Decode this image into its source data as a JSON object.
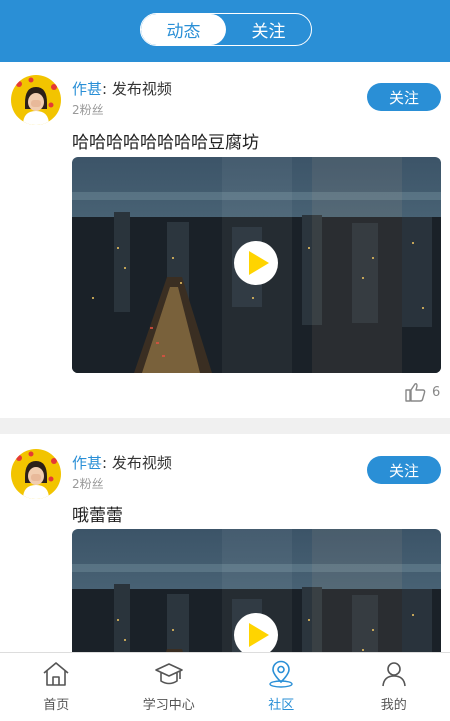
{
  "header": {
    "tabs": [
      {
        "label": "动态",
        "active": true
      },
      {
        "label": "关注",
        "active": false
      }
    ]
  },
  "posts": [
    {
      "author": "作甚",
      "action": ": 发布视频",
      "fans": "2粉丝",
      "follow_label": "关注",
      "title": "哈哈哈哈哈哈哈哈豆腐坊",
      "likes": "6"
    },
    {
      "author": "作甚",
      "action": ": 发布视频",
      "fans": "2粉丝",
      "follow_label": "关注",
      "title": "哦蕾蕾"
    }
  ],
  "tabbar": {
    "items": [
      {
        "label": "首页",
        "icon": "home-icon",
        "active": false
      },
      {
        "label": "学习中心",
        "icon": "graduation-cap-icon",
        "active": false
      },
      {
        "label": "社区",
        "icon": "location-pin-icon",
        "active": true
      },
      {
        "label": "我的",
        "icon": "user-icon",
        "active": false
      }
    ]
  },
  "colors": {
    "accent": "#2a8fd6",
    "play": "#ffd400"
  }
}
